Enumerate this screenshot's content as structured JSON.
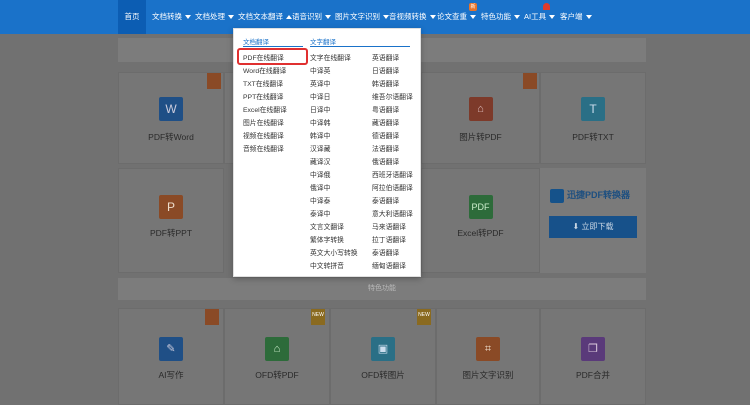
{
  "nav": {
    "items": [
      {
        "label": "首页",
        "caret": false
      },
      {
        "label": "文档转换",
        "caret": true
      },
      {
        "label": "文档处理",
        "caret": true
      },
      {
        "label": "文档文本翻译",
        "caret": true
      },
      {
        "label": "语音识别",
        "caret": true
      },
      {
        "label": "图片文字识别",
        "caret": true
      },
      {
        "label": "音视频转换",
        "caret": true
      },
      {
        "label": "论文查重",
        "caret": true
      },
      {
        "label": "特色功能",
        "caret": true
      },
      {
        "label": "AI工具",
        "caret": true
      },
      {
        "label": "客户端",
        "caret": true
      }
    ],
    "badge_paper": "新"
  },
  "dropdown": {
    "doc_heading": "文档翻译",
    "text_heading": "文字翻译",
    "doc_items": [
      "PDF在线翻译",
      "Word在线翻译",
      "TXT在线翻译",
      "PPT在线翻译",
      "Excel在线翻译",
      "图片在线翻译",
      "视频在线翻译",
      "音频在线翻译"
    ],
    "text_col1": [
      "文字在线翻译",
      "中译英",
      "英译中",
      "中译日",
      "日译中",
      "中译韩",
      "韩译中",
      "汉译藏",
      "藏译汉",
      "中译俄",
      "俄译中",
      "中译泰",
      "泰译中",
      "文言文翻译",
      "繁体字转换",
      "英文大小写转换",
      "中文转拼音"
    ],
    "text_col2": [
      "英语翻译",
      "日语翻译",
      "韩语翻译",
      "维吾尔语翻译",
      "粤语翻译",
      "藏语翻译",
      "德语翻译",
      "法语翻译",
      "俄语翻译",
      "西班牙语翻译",
      "阿拉伯语翻译",
      "泰语翻译",
      "意大利语翻译",
      "马来语翻译",
      "拉丁语翻译",
      "泰语翻译",
      "缅甸语翻译"
    ]
  },
  "cards_row1": [
    "PDF转Word",
    "图片转PDF",
    "PDF转TXT"
  ],
  "cards_row2": [
    "PDF转PPT",
    "Excel转PDF"
  ],
  "section_title": "特色功能",
  "cards_row3": [
    "AI写作",
    "OFD转PDF",
    "OFD转图片",
    "图片文字识别",
    "PDF合并"
  ],
  "new_label": "NEW",
  "promo": {
    "title": "迅捷PDF转换器",
    "button": "立即下载"
  },
  "colors": {
    "nav_bg": "#1a72c9",
    "accent": "#1a72c9",
    "highlight": "#e03030"
  }
}
